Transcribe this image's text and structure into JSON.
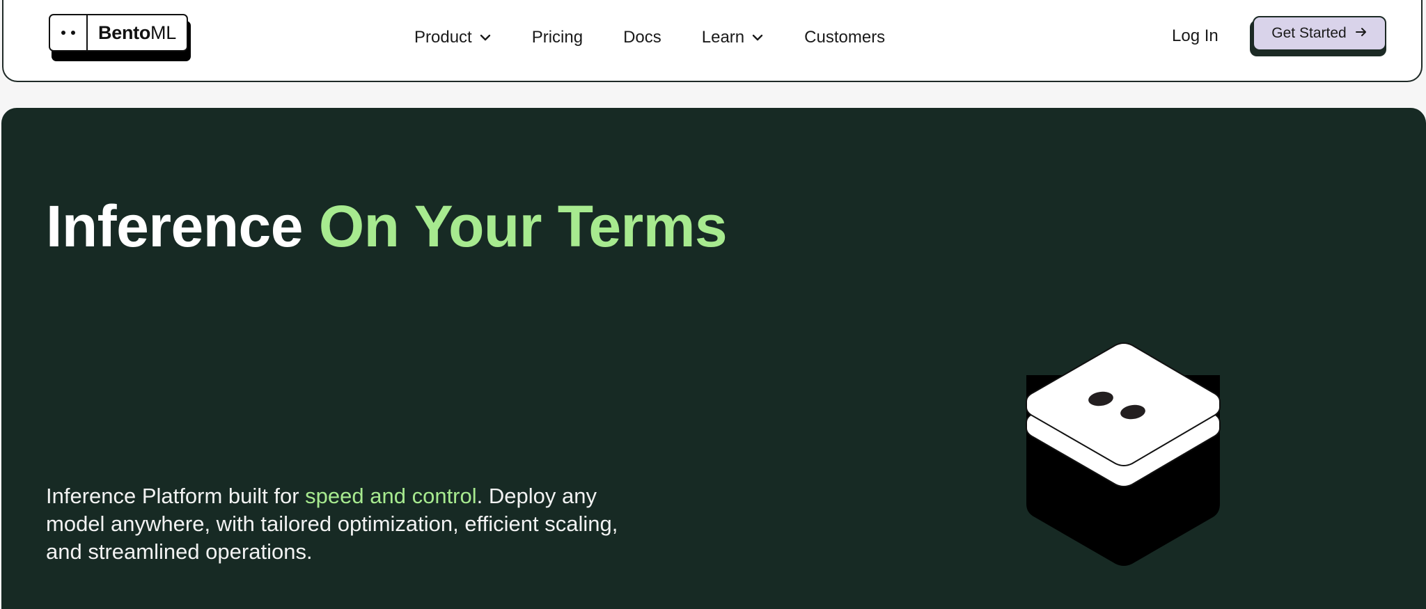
{
  "brand": {
    "logo_bold": "Bento",
    "logo_light": "ML"
  },
  "nav": {
    "items": [
      {
        "label": "Product",
        "has_dropdown": true
      },
      {
        "label": "Pricing",
        "has_dropdown": false
      },
      {
        "label": "Docs",
        "has_dropdown": false
      },
      {
        "label": "Learn",
        "has_dropdown": true
      },
      {
        "label": "Customers",
        "has_dropdown": false
      }
    ],
    "login_label": "Log In",
    "cta_label": "Get Started"
  },
  "hero": {
    "title_plain": "Inference ",
    "title_accent": "On Your Terms",
    "sub_before": "Inference Platform built for ",
    "sub_highlight": "speed and control",
    "sub_after": ". Deploy any model anywhere, with tailored optimization, efficient scaling, and streamlined operations."
  },
  "colors": {
    "hero_bg": "#172a24",
    "accent_green": "#a7ea8f",
    "cta_bg": "#d9d3ea"
  },
  "icons": [
    "chevron-down-icon",
    "arrow-right-icon",
    "bento-box-illustration"
  ]
}
